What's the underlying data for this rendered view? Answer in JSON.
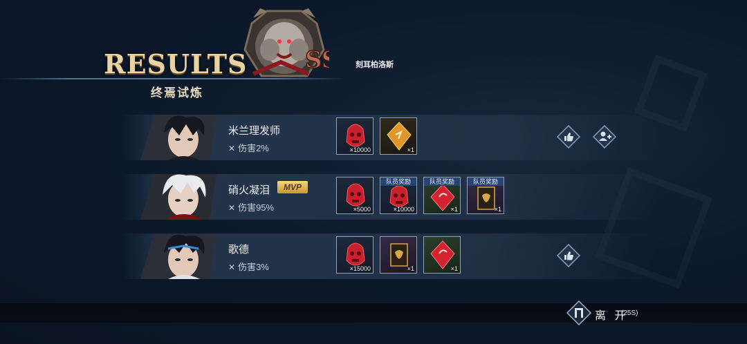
{
  "header": {
    "title": "RESULTS",
    "subtitle": "终焉试炼",
    "boss_name": "刻耳柏洛斯",
    "boss_icon": "boss-beast-icon"
  },
  "players": [
    {
      "name": "米兰理发师",
      "damage": "伤害2%",
      "mvp": false,
      "rewards": [
        {
          "icon": "red-mask-icon",
          "qty": "×10000",
          "badge": ""
        },
        {
          "icon": "orange-crystal-icon",
          "qty": "×1",
          "badge": ""
        }
      ],
      "actions": [
        "like",
        "add-friend"
      ]
    },
    {
      "name": "硝火凝泪",
      "damage": "伤害95%",
      "mvp": true,
      "mvp_label": "MVP",
      "rewards": [
        {
          "icon": "red-mask-icon",
          "qty": "×5000",
          "badge": ""
        },
        {
          "icon": "red-mask-icon",
          "qty": "×10000",
          "badge": "队员奖励"
        },
        {
          "icon": "red-crystal-icon",
          "qty": "×1",
          "badge": "队员奖励"
        },
        {
          "icon": "gold-card-icon",
          "qty": "×1",
          "badge": "队员奖励"
        }
      ],
      "actions": []
    },
    {
      "name": "歌德",
      "damage": "伤害3%",
      "mvp": false,
      "rewards": [
        {
          "icon": "red-mask-icon",
          "qty": "×15000",
          "badge": ""
        },
        {
          "icon": "gold-card-icon",
          "qty": "×1",
          "badge": ""
        },
        {
          "icon": "red-crystal-icon",
          "qty": "×1",
          "badge": ""
        }
      ],
      "actions": [
        "like"
      ]
    }
  ],
  "footer": {
    "exit_label": "离 开",
    "timer": "(25S)"
  },
  "colors": {
    "accent_gold": "#e8d3a6",
    "panel": "#243448",
    "red_item": "#c8202c"
  }
}
